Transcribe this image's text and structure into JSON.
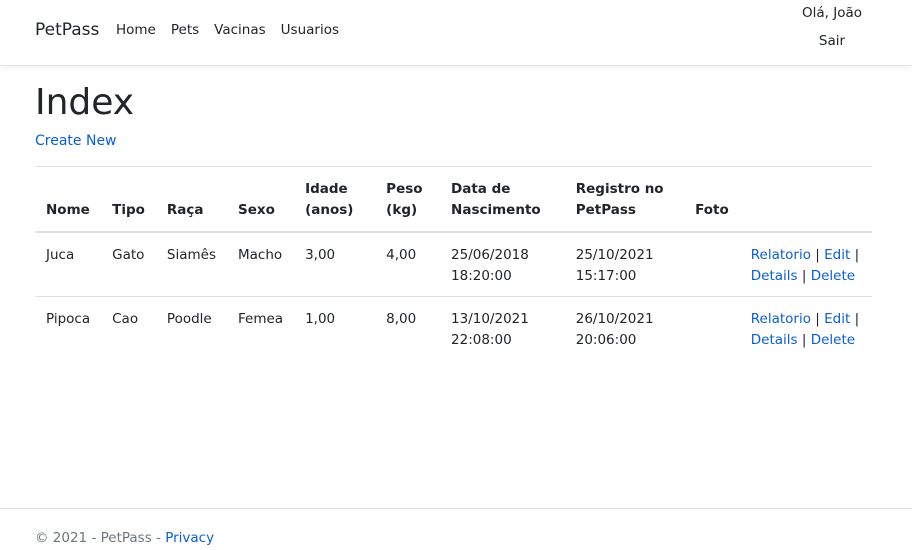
{
  "navbar": {
    "brand": "PetPass",
    "links": [
      "Home",
      "Pets",
      "Vacinas",
      "Usuarios"
    ],
    "greeting": "Olá, João",
    "logout": "Sair"
  },
  "main": {
    "title": "Index",
    "create_link": "Create New",
    "columns": {
      "nome": "Nome",
      "tipo": "Tipo",
      "raca": "Raça",
      "sexo": "Sexo",
      "idade": [
        "Idade",
        "(anos)"
      ],
      "peso": [
        "Peso",
        "(kg)"
      ],
      "nascimento": [
        "Data de",
        "Nascimento"
      ],
      "registro": [
        "Registro no",
        "PetPass"
      ],
      "foto": "Foto"
    },
    "rows": [
      {
        "nome": "Juca",
        "tipo": "Gato",
        "raca": "Siamês",
        "sexo": "Macho",
        "idade": "3,00",
        "peso": "4,00",
        "nascimento": [
          "25/06/2018",
          "18:20:00"
        ],
        "registro": [
          "25/10/2021",
          "15:17:00"
        ]
      },
      {
        "nome": "Pipoca",
        "tipo": "Cao",
        "raca": "Poodle",
        "sexo": "Femea",
        "idade": "1,00",
        "peso": "8,00",
        "nascimento": [
          "13/10/2021",
          "22:08:00"
        ],
        "registro": [
          "26/10/2021",
          "20:06:00"
        ]
      }
    ],
    "actions": {
      "relatorio": "Relatorio",
      "edit": "Edit",
      "details": "Details",
      "delete": "Delete",
      "separator": "|"
    }
  },
  "footer": {
    "text": "© 2021 - PetPass -",
    "privacy": "Privacy"
  }
}
